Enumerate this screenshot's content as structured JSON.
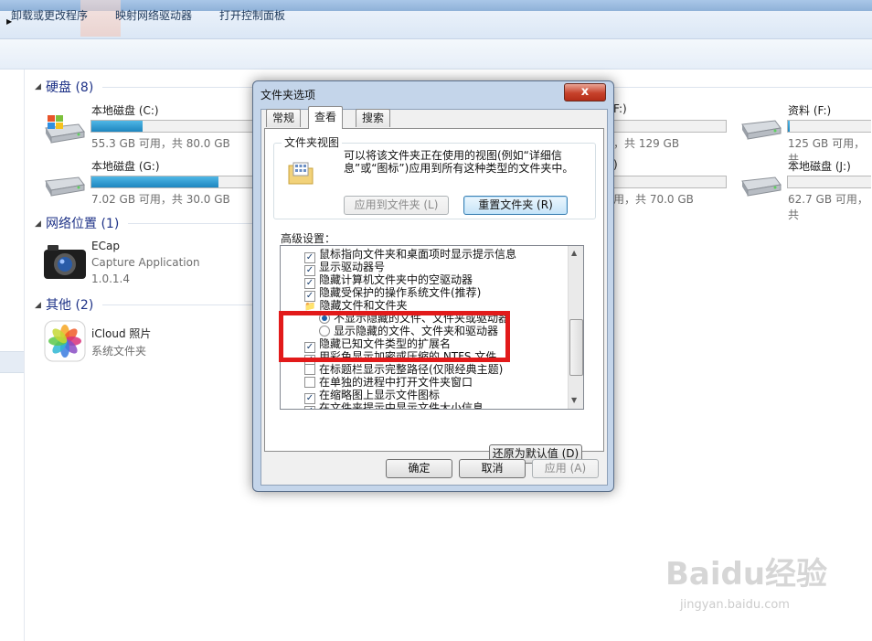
{
  "toolbar": {
    "items": [
      "卸载或更改程序",
      "映射网络驱动器",
      "打开控制面板"
    ]
  },
  "sections": {
    "drives": "硬盘 (8)",
    "network": "网络位置 (1)",
    "other": "其他 (2)"
  },
  "drives": [
    {
      "name": "本地磁盘 (C:)",
      "info": "55.3 GB 可用，共 80.0 GB",
      "used": 0.31
    },
    {
      "name": "本地磁盘 (G:)",
      "info": "7.02 GB 可用，共 30.0 GB",
      "used": 0.77
    },
    {
      "name": "资料 (F:)",
      "info": "125 GB 可用，共",
      "used": 0.02
    },
    {
      "name": "本地磁盘 (J:)",
      "info": "62.7 GB 可用，共",
      "used": 0.0
    }
  ],
  "partial_drives": [
    {
      "fragment": "F:)",
      "info": "，共 129 GB"
    },
    {
      "fragment": ")",
      "info": "用，共 70.0 GB"
    }
  ],
  "network_item": {
    "title": "ECap",
    "subtitle": "Capture Application",
    "version": "1.0.1.4"
  },
  "other_item": {
    "title": "iCloud 照片",
    "subtitle": "系统文件夹"
  },
  "dialog": {
    "title": "文件夹选项",
    "close": "x",
    "tabs": [
      "常规",
      "查看",
      "搜索"
    ],
    "folder_view_label": "文件夹视图",
    "folder_view_desc": "可以将该文件夹正在使用的视图(例如“详细信息”或“图标”)应用到所有这种类型的文件夹中。",
    "apply_to_folders": "应用到文件夹 (L)",
    "reset_folders": "重置文件夹 (R)",
    "advanced_label": "高级设置：",
    "list_items": [
      {
        "type": "check",
        "checked": true,
        "indent": 1,
        "label": "鼠标指向文件夹和桌面项时显示提示信息"
      },
      {
        "type": "check",
        "checked": true,
        "indent": 1,
        "label": "显示驱动器号"
      },
      {
        "type": "check",
        "checked": true,
        "indent": 1,
        "label": "隐藏计算机文件夹中的空驱动器"
      },
      {
        "type": "check",
        "checked": true,
        "indent": 1,
        "label": "隐藏受保护的操作系统文件(推荐)"
      },
      {
        "type": "folder",
        "checked": false,
        "indent": 1,
        "label": "隐藏文件和文件夹"
      },
      {
        "type": "radio",
        "checked": true,
        "indent": 2,
        "label": "不显示隐藏的文件、文件夹或驱动器"
      },
      {
        "type": "radio",
        "checked": false,
        "indent": 2,
        "label": "显示隐藏的文件、文件夹和驱动器"
      },
      {
        "type": "check",
        "checked": true,
        "indent": 1,
        "label": "隐藏已知文件类型的扩展名"
      },
      {
        "type": "check",
        "checked": true,
        "indent": 1,
        "label": "用彩色显示加密或压缩的 NTFS 文件"
      },
      {
        "type": "check",
        "checked": false,
        "indent": 1,
        "label": "在标题栏显示完整路径(仅限经典主题)"
      },
      {
        "type": "check",
        "checked": false,
        "indent": 1,
        "label": "在单独的进程中打开文件夹窗口"
      },
      {
        "type": "check",
        "checked": true,
        "indent": 1,
        "label": "在缩略图上显示文件图标"
      },
      {
        "type": "check",
        "checked": true,
        "indent": 1,
        "label": "在文件夹提示中显示文件大小信息"
      }
    ],
    "restore_defaults": "还原为默认值 (D)",
    "ok": "确定",
    "cancel": "取消",
    "apply": "应用 (A)"
  },
  "watermark": {
    "brand": "Baidu经验",
    "url": "jingyan.baidu.com"
  },
  "colors": {
    "highlight": "#e21a1a",
    "section_title": "#1e3287",
    "bar_fill": "#1e86bf"
  }
}
